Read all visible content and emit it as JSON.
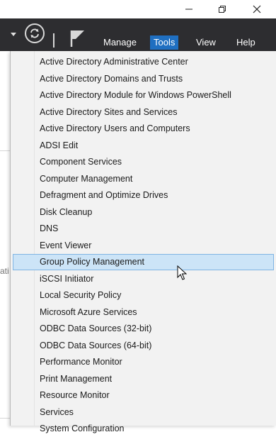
{
  "toolbar": {
    "menu": [
      "Manage",
      "Tools",
      "View",
      "Help"
    ],
    "active_menu": "Tools"
  },
  "background": {
    "fragment_text": "ati"
  },
  "dropdown": {
    "items": [
      "Active Directory Administrative Center",
      "Active Directory Domains and Trusts",
      "Active Directory Module for Windows PowerShell",
      "Active Directory Sites and Services",
      "Active Directory Users and Computers",
      "ADSI Edit",
      "Component Services",
      "Computer Management",
      "Defragment and Optimize Drives",
      "Disk Cleanup",
      "DNS",
      "Event Viewer",
      "Group Policy Management",
      "iSCSI Initiator",
      "Local Security Policy",
      "Microsoft Azure Services",
      "ODBC Data Sources (32-bit)",
      "ODBC Data Sources (64-bit)",
      "Performance Monitor",
      "Print Management",
      "Resource Monitor",
      "Services",
      "System Configuration"
    ],
    "highlighted": "Group Policy Management"
  },
  "colors": {
    "toolbar_bg": "#2d2d30",
    "active_menu_bg": "#1f6fc1",
    "highlight_bg": "#cce4f7",
    "highlight_border": "#7fb4e3",
    "dropdown_bg": "#f2f2f2"
  }
}
